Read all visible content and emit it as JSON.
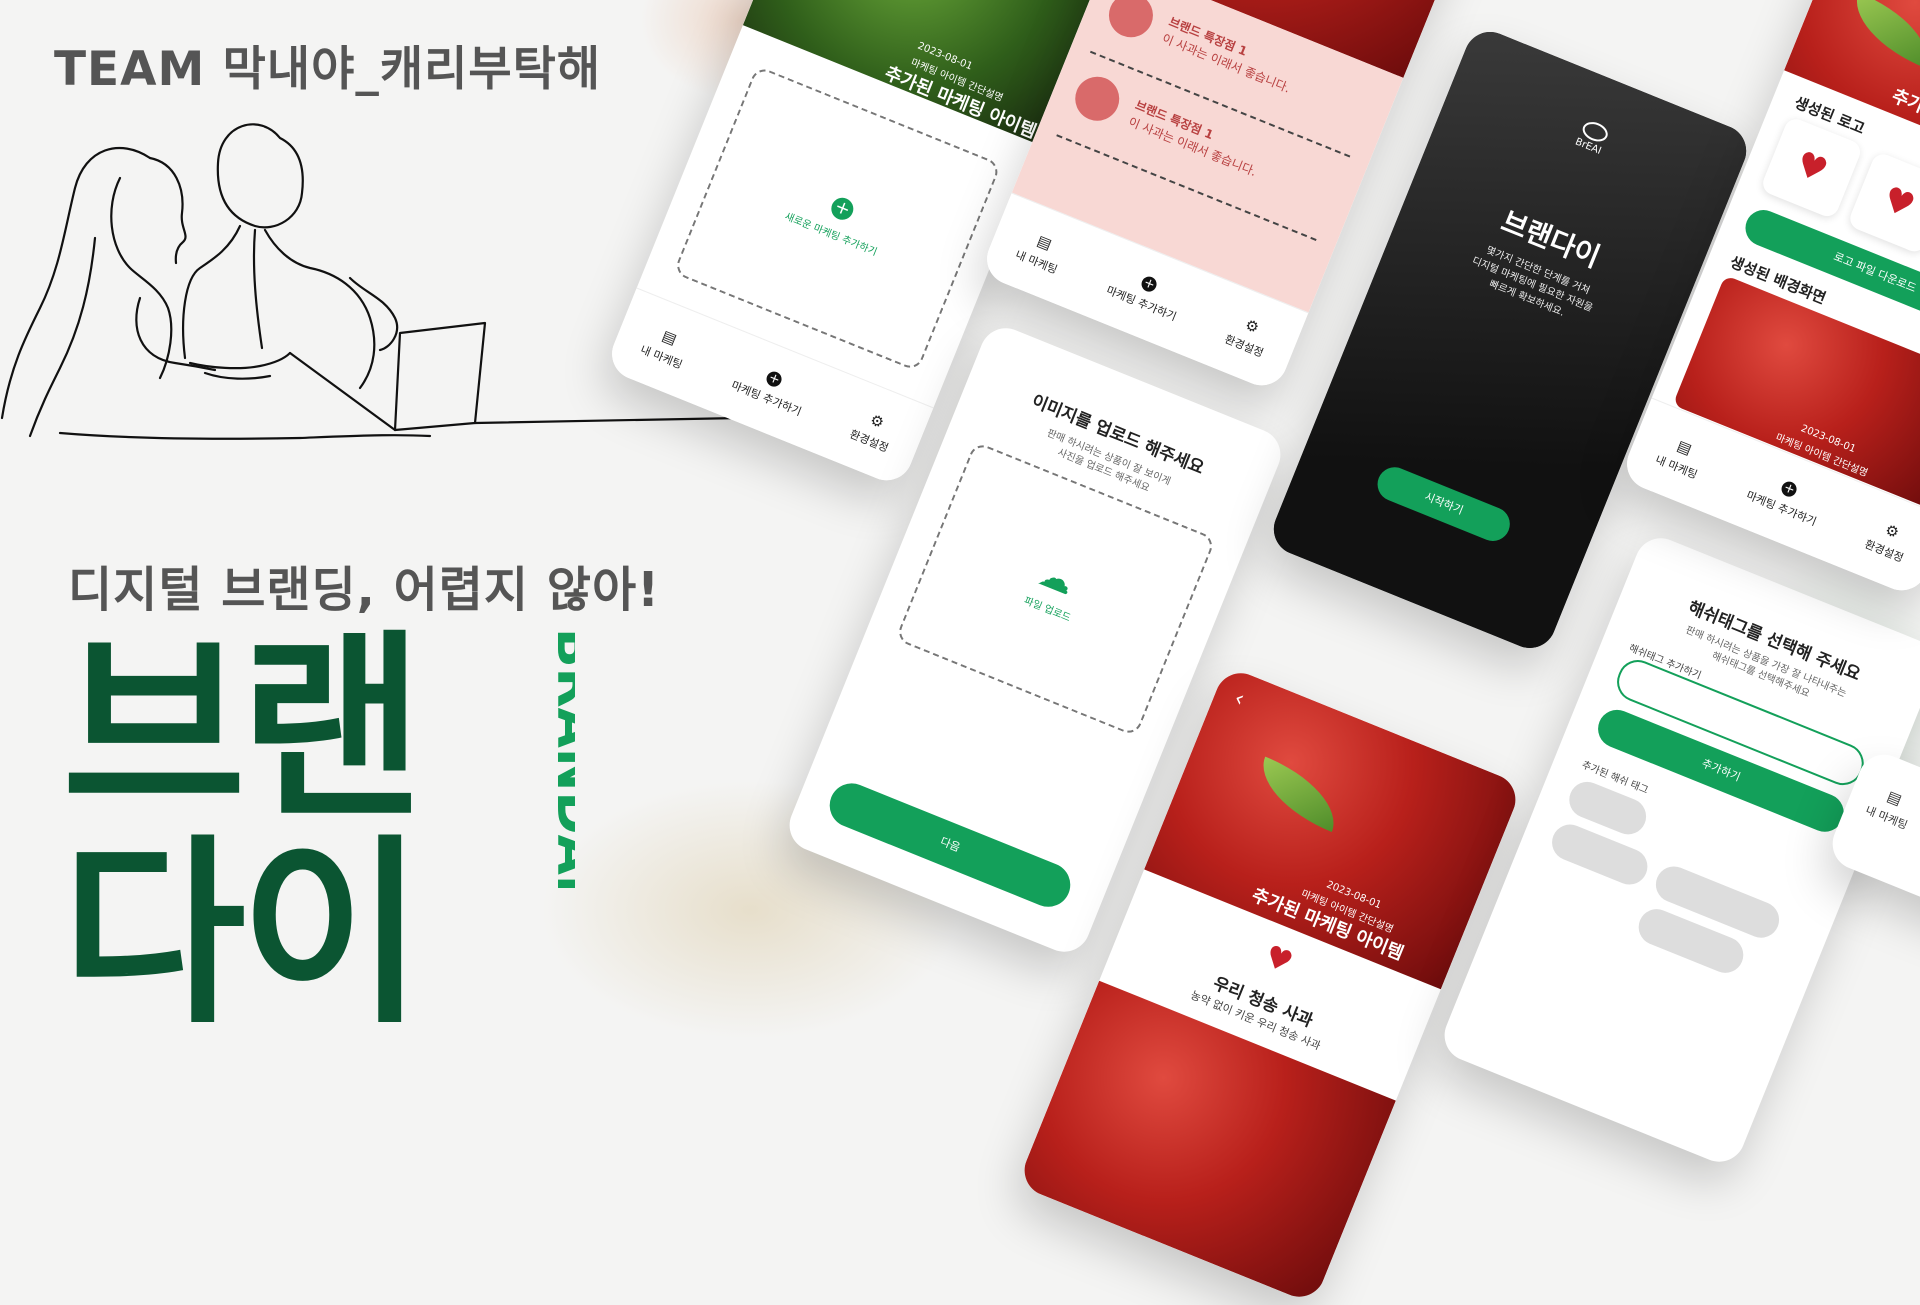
{
  "team_title": "TEAM 막내야_캐리부탁해",
  "tagline": "디지털 브랜딩, 어렵지 않아!",
  "brand_kr_line1": "브랜",
  "brand_kr_line2": "다이",
  "brand_en": "BRANDAI",
  "colors": {
    "brand_green": "#0b5532",
    "accent_green": "#13a05a",
    "pink_bg": "#f8d8d4"
  },
  "nav": {
    "my_marketing": "내 마케팅",
    "add_marketing": "마케팅 추가하기",
    "settings": "환경설정"
  },
  "phone_add_item": {
    "date": "2023-08-01",
    "subtitle": "마케팅 아이템 간단설명",
    "title": "추가된 마케팅 아이템",
    "add_new": "새로운 마케팅 추가하기"
  },
  "phone_features": {
    "features": [
      {
        "title": "브랜드 특장점 1",
        "desc": "이 사과는 이래서 좋습니다."
      },
      {
        "title": "브랜드 특장점 1",
        "desc": "이 사과는 이래서 좋습니다."
      }
    ]
  },
  "phone_upload": {
    "title": "이미지를 업로드 해주세요",
    "desc_line1": "판매 하시려는 상품이 잘 보이게",
    "desc_line2": "사진을 업로드 해주세요",
    "upload_label": "파일 업로드",
    "next_button": "다음"
  },
  "phone_splash": {
    "logo_text": "BrEAI",
    "title": "브랜다이",
    "desc_line1": "몇가지 간단한 단계를 거쳐",
    "desc_line2": "디지털 마케팅에 필요한 자원을",
    "desc_line3": "빠르게 확보하세요.",
    "start_button": "시작하기"
  },
  "phone_detail": {
    "date": "2023-08-01",
    "subtitle": "마케팅 아이템 간단설명",
    "title": "추가된 마케팅 아이템",
    "product_name": "우리 청송 사과",
    "product_desc": "농약 없이 키운 우리 청송 사과",
    "back_icon": "‹"
  },
  "phone_hashtag": {
    "title": "해쉬태그를 선택해 주세요",
    "desc_line1": "판매 하시려는 상품을 가장 잘 나타내주는",
    "desc_line2": "해쉬태그를 선택해주세요",
    "field_label": "해쉬태그 추가하기",
    "add_button": "추가하기",
    "added_label": "추가된 해쉬 태그"
  },
  "phone_results": {
    "title_partial": "추가된 마",
    "logo_section": "생성된 로고",
    "download_button": "로고 파일 다운로드",
    "bg_section": "생성된 배경화면",
    "date": "2023-08-01",
    "subtitle": "마케팅 아이템 간단설명",
    "back_icon": "‹"
  },
  "phone_edge": {
    "nav_label": "내 마케팅"
  }
}
